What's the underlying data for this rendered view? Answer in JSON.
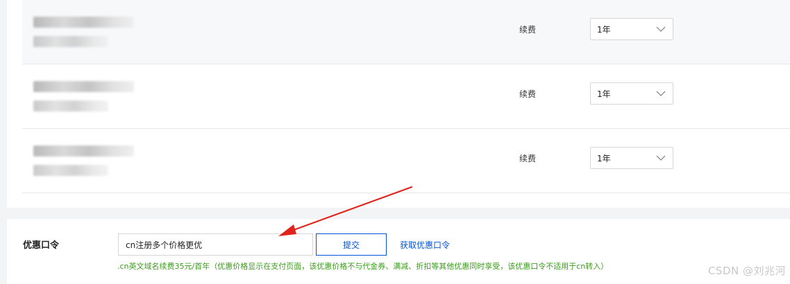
{
  "rows": [
    {
      "renew_label": "续费",
      "period": "1年"
    },
    {
      "renew_label": "续费",
      "period": "1年"
    },
    {
      "renew_label": "续费",
      "period": "1年"
    }
  ],
  "promo": {
    "label": "优惠口令",
    "input_value": "cn注册多个价格更优",
    "submit_label": "提交",
    "get_code_link": "获取优惠口令",
    "hint": ".cn英文域名续费35元/首年（优惠价格显示在支付页面，该优惠价格不与代金券、满减、折扣等其他优惠同时享受，该优惠口令不适用于cn转入）"
  },
  "watermark": "CSDN @刘兆河",
  "colors": {
    "accent": "#0052d9",
    "hint_green": "#3a9c1a",
    "annotation_arrow": "#e0241b"
  }
}
